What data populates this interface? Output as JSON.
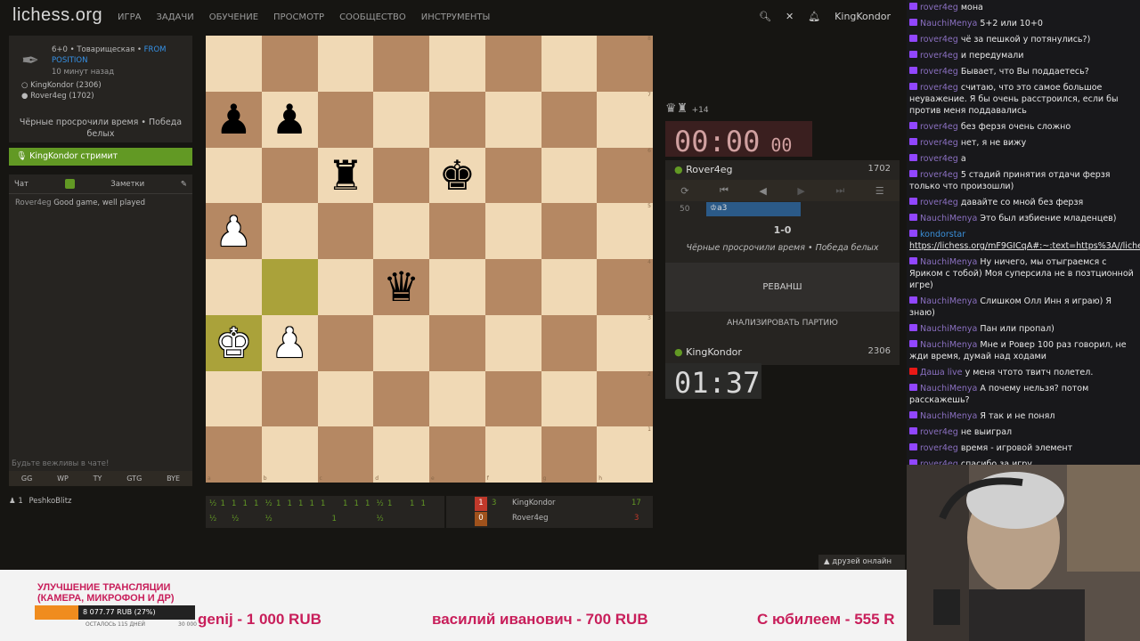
{
  "site": {
    "logo": "lichess.org"
  },
  "nav": [
    "ИГРА",
    "ЗАДАЧИ",
    "ОБУЧЕНИЕ",
    "ПРОСМОТР",
    "СООБЩЕСТВО",
    "ИНСТРУМЕНТЫ"
  ],
  "user": {
    "name": "KingKondor"
  },
  "game": {
    "type": "6+0 • Товарищеская •",
    "position_link": "FROM POSITION",
    "time_ago": "10 минут назад",
    "white": "KingKondor (2306)",
    "black": "Rover4eg (1702)",
    "result_text": "Чёрные просрочили время • Победа белых"
  },
  "streamer": {
    "label": "KingKondor стримит"
  },
  "chat": {
    "tab_chat": "Чат",
    "tab_notes": "Заметки",
    "messages": [
      {
        "user": "Rover4eg",
        "text": "Good game, well played"
      }
    ],
    "placeholder": "Будьте вежливы в чате!",
    "quick": [
      "GG",
      "WP",
      "TY",
      "GTG",
      "BYE"
    ]
  },
  "spectators": {
    "count": "1",
    "name": "PeshkoBlitz"
  },
  "board": {
    "files": [
      "a",
      "b",
      "c",
      "d",
      "e",
      "f",
      "g",
      "h"
    ],
    "ranks": [
      "8",
      "7",
      "6",
      "5",
      "4",
      "3",
      "2",
      "1"
    ],
    "pieces": [
      {
        "sq": "a7",
        "p": "♟",
        "c": "b"
      },
      {
        "sq": "b7",
        "p": "♟",
        "c": "b"
      },
      {
        "sq": "c6",
        "p": "♜",
        "c": "b"
      },
      {
        "sq": "e6",
        "p": "♚",
        "c": "b"
      },
      {
        "sq": "a5",
        "p": "♟",
        "c": "w"
      },
      {
        "sq": "d4",
        "p": "♛",
        "c": "b"
      },
      {
        "sq": "a3",
        "p": "♚",
        "c": "w"
      },
      {
        "sq": "b3",
        "p": "♟",
        "c": "w"
      }
    ],
    "highlight": [
      "b4",
      "a3"
    ]
  },
  "crosstable": {
    "row1": [
      "½",
      "1",
      "1",
      "1",
      "1",
      "½",
      "1",
      "1",
      "1",
      "1",
      "1",
      "",
      "1",
      "1",
      "1",
      "½",
      "1",
      "",
      "1",
      "1"
    ],
    "row2": [
      "½",
      "",
      "½",
      "",
      "",
      "½",
      "",
      "",
      "",
      "",
      "",
      "1",
      "",
      "",
      "",
      "½"
    ],
    "score1_a": "1",
    "score1_b": "3",
    "player1": "KingKondor",
    "total1": "17",
    "score2_a": "0",
    "score2_b": "",
    "player2": "Rover4eg",
    "total2": "3"
  },
  "right": {
    "material": "+14",
    "clock_black": "00:00",
    "clock_black_tenths": "00",
    "black_name": "Rover4eg",
    "black_rating": "1702",
    "move_no": "50",
    "move": "♔a3",
    "score": "1-0",
    "result": "Чёрные просрочили время • Победа белых",
    "rematch": "РЕВАНШ",
    "analyze": "АНАЛИЗИРОВАТЬ ПАРТИЮ",
    "white_name": "KingKondor",
    "white_rating": "2306",
    "clock_white": "01:37"
  },
  "stream_chat": [
    {
      "u": "rover4eg",
      "t": "мона"
    },
    {
      "u": "NauchiMenya",
      "t": "5+2 или 10+0"
    },
    {
      "u": "rover4eg",
      "t": "чё за пешкой у потянулись?)"
    },
    {
      "u": "rover4eg",
      "t": "и передумали"
    },
    {
      "u": "rover4eg",
      "t": "Бывает, что Вы поддаетесь?"
    },
    {
      "u": "rover4eg",
      "t": "считаю, что это самое большое неуважение. Я бы очень расстроился, если бы против меня поддавались"
    },
    {
      "u": "rover4eg",
      "t": "без ферзя очень сложно"
    },
    {
      "u": "rover4eg",
      "t": "нет, я не вижу"
    },
    {
      "u": "rover4eg",
      "t": "а"
    },
    {
      "u": "rover4eg",
      "t": "5 стадий принятия отдачи ферзя только что произошли)"
    },
    {
      "u": "rover4eg",
      "t": "давайте со мной без ферзя"
    },
    {
      "u": "NauchiMenya",
      "t": "Это был избиение младенцев)"
    },
    {
      "u": "kondorstar",
      "t": "https://lichess.org/mF9GICqA#:~:text=https%3A//lichess.org/mF9GICqA"
    },
    {
      "u": "NauchiMenya",
      "t": "Ну ничего, мы отыграемся с Яриком с тобой) Моя суперсила не в позтционной игре)"
    },
    {
      "u": "NauchiMenya",
      "t": "Слишком Олл Инн я играю) Я знаю)"
    },
    {
      "u": "NauchiMenya",
      "t": "Пан или пропал)"
    },
    {
      "u": "NauchiMenya",
      "t": "Мне и Ровер 100 раз говорил, не жди время, думай над ходами"
    },
    {
      "u": "Даша live",
      "t": "у меня чтото твитч полетел.",
      "red": true
    },
    {
      "u": "NauchiMenya",
      "t": "А почему нельзя? потом расскажешь?"
    },
    {
      "u": "NauchiMenya",
      "t": "Я так и не понял"
    },
    {
      "u": "rover4eg",
      "t": "не выиграл"
    },
    {
      "u": "rover4eg",
      "t": "время - игровой элемент"
    },
    {
      "u": "rover4eg",
      "t": "спасибо за игру"
    }
  ],
  "friends": "друзей онлайн",
  "donation": {
    "title": "УЛУЧШЕНИЕ ТРАНСЛЯЦИИ (КАМЕРА, МИКРОФОН И ДР)",
    "progress_text": "8 077.77 RUB (27%)",
    "progress": 0.27,
    "left_text": "ОСТАЛОСЬ 115 ДНЕЙ",
    "goal": "30 000"
  },
  "ticker": [
    "genij - 1 000 RUB",
    "василий иванович - 700 RUB",
    "С юбилеем - 555 R"
  ]
}
